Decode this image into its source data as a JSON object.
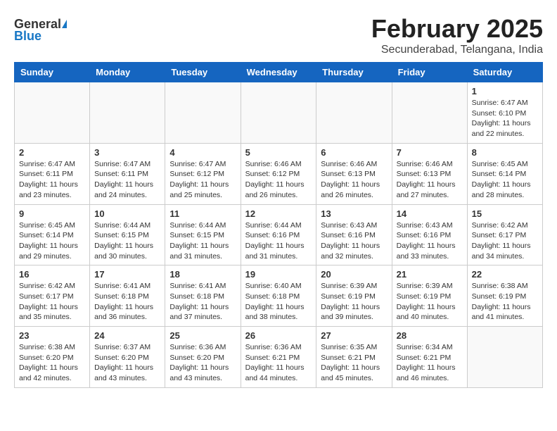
{
  "logo": {
    "general": "General",
    "blue": "Blue"
  },
  "header": {
    "title": "February 2025",
    "subtitle": "Secunderabad, Telangana, India"
  },
  "weekdays": [
    "Sunday",
    "Monday",
    "Tuesday",
    "Wednesday",
    "Thursday",
    "Friday",
    "Saturday"
  ],
  "weeks": [
    [
      {
        "day": "",
        "info": ""
      },
      {
        "day": "",
        "info": ""
      },
      {
        "day": "",
        "info": ""
      },
      {
        "day": "",
        "info": ""
      },
      {
        "day": "",
        "info": ""
      },
      {
        "day": "",
        "info": ""
      },
      {
        "day": "1",
        "info": "Sunrise: 6:47 AM\nSunset: 6:10 PM\nDaylight: 11 hours and 22 minutes."
      }
    ],
    [
      {
        "day": "2",
        "info": "Sunrise: 6:47 AM\nSunset: 6:11 PM\nDaylight: 11 hours and 23 minutes."
      },
      {
        "day": "3",
        "info": "Sunrise: 6:47 AM\nSunset: 6:11 PM\nDaylight: 11 hours and 24 minutes."
      },
      {
        "day": "4",
        "info": "Sunrise: 6:47 AM\nSunset: 6:12 PM\nDaylight: 11 hours and 25 minutes."
      },
      {
        "day": "5",
        "info": "Sunrise: 6:46 AM\nSunset: 6:12 PM\nDaylight: 11 hours and 26 minutes."
      },
      {
        "day": "6",
        "info": "Sunrise: 6:46 AM\nSunset: 6:13 PM\nDaylight: 11 hours and 26 minutes."
      },
      {
        "day": "7",
        "info": "Sunrise: 6:46 AM\nSunset: 6:13 PM\nDaylight: 11 hours and 27 minutes."
      },
      {
        "day": "8",
        "info": "Sunrise: 6:45 AM\nSunset: 6:14 PM\nDaylight: 11 hours and 28 minutes."
      }
    ],
    [
      {
        "day": "9",
        "info": "Sunrise: 6:45 AM\nSunset: 6:14 PM\nDaylight: 11 hours and 29 minutes."
      },
      {
        "day": "10",
        "info": "Sunrise: 6:44 AM\nSunset: 6:15 PM\nDaylight: 11 hours and 30 minutes."
      },
      {
        "day": "11",
        "info": "Sunrise: 6:44 AM\nSunset: 6:15 PM\nDaylight: 11 hours and 31 minutes."
      },
      {
        "day": "12",
        "info": "Sunrise: 6:44 AM\nSunset: 6:16 PM\nDaylight: 11 hours and 31 minutes."
      },
      {
        "day": "13",
        "info": "Sunrise: 6:43 AM\nSunset: 6:16 PM\nDaylight: 11 hours and 32 minutes."
      },
      {
        "day": "14",
        "info": "Sunrise: 6:43 AM\nSunset: 6:16 PM\nDaylight: 11 hours and 33 minutes."
      },
      {
        "day": "15",
        "info": "Sunrise: 6:42 AM\nSunset: 6:17 PM\nDaylight: 11 hours and 34 minutes."
      }
    ],
    [
      {
        "day": "16",
        "info": "Sunrise: 6:42 AM\nSunset: 6:17 PM\nDaylight: 11 hours and 35 minutes."
      },
      {
        "day": "17",
        "info": "Sunrise: 6:41 AM\nSunset: 6:18 PM\nDaylight: 11 hours and 36 minutes."
      },
      {
        "day": "18",
        "info": "Sunrise: 6:41 AM\nSunset: 6:18 PM\nDaylight: 11 hours and 37 minutes."
      },
      {
        "day": "19",
        "info": "Sunrise: 6:40 AM\nSunset: 6:18 PM\nDaylight: 11 hours and 38 minutes."
      },
      {
        "day": "20",
        "info": "Sunrise: 6:39 AM\nSunset: 6:19 PM\nDaylight: 11 hours and 39 minutes."
      },
      {
        "day": "21",
        "info": "Sunrise: 6:39 AM\nSunset: 6:19 PM\nDaylight: 11 hours and 40 minutes."
      },
      {
        "day": "22",
        "info": "Sunrise: 6:38 AM\nSunset: 6:19 PM\nDaylight: 11 hours and 41 minutes."
      }
    ],
    [
      {
        "day": "23",
        "info": "Sunrise: 6:38 AM\nSunset: 6:20 PM\nDaylight: 11 hours and 42 minutes."
      },
      {
        "day": "24",
        "info": "Sunrise: 6:37 AM\nSunset: 6:20 PM\nDaylight: 11 hours and 43 minutes."
      },
      {
        "day": "25",
        "info": "Sunrise: 6:36 AM\nSunset: 6:20 PM\nDaylight: 11 hours and 43 minutes."
      },
      {
        "day": "26",
        "info": "Sunrise: 6:36 AM\nSunset: 6:21 PM\nDaylight: 11 hours and 44 minutes."
      },
      {
        "day": "27",
        "info": "Sunrise: 6:35 AM\nSunset: 6:21 PM\nDaylight: 11 hours and 45 minutes."
      },
      {
        "day": "28",
        "info": "Sunrise: 6:34 AM\nSunset: 6:21 PM\nDaylight: 11 hours and 46 minutes."
      },
      {
        "day": "",
        "info": ""
      }
    ]
  ]
}
